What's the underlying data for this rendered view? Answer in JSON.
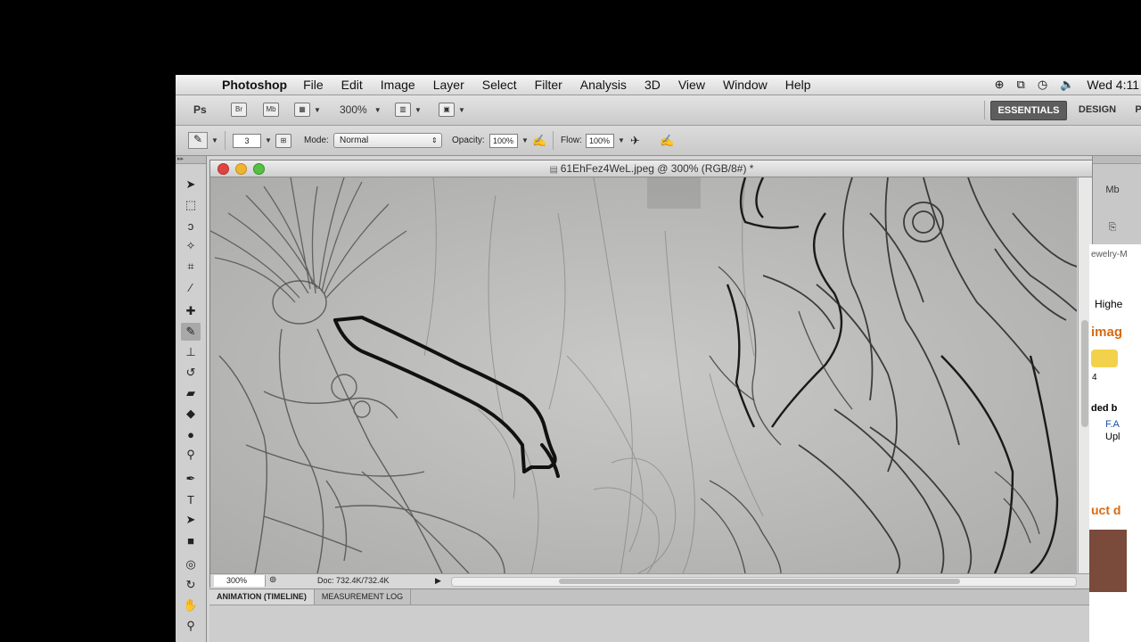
{
  "menubar": {
    "app": "Photoshop",
    "items": [
      "File",
      "Edit",
      "Image",
      "Layer",
      "Select",
      "Filter",
      "Analysis",
      "3D",
      "View",
      "Window",
      "Help"
    ],
    "clock": "Wed 4:11"
  },
  "appbar": {
    "logo": "Ps",
    "br": "Br",
    "mb": "Mb",
    "zoom": "300%",
    "workspaces": [
      "ESSENTIALS",
      "DESIGN",
      "P"
    ]
  },
  "options": {
    "brush_size": "3",
    "mode_label": "Mode:",
    "mode_value": "Normal",
    "opacity_label": "Opacity:",
    "opacity_value": "100%",
    "flow_label": "Flow:",
    "flow_value": "100%"
  },
  "document": {
    "title": "61EhFez4WeL.jpeg @ 300% (RGB/8#) *",
    "zoom": "300%",
    "doc_info": "Doc: 732.4K/732.4K"
  },
  "bottom_panel": {
    "tabs": [
      "ANIMATION (TIMELINE)",
      "MEASUREMENT LOG"
    ]
  },
  "background_page": {
    "texts": [
      "ewelry-M",
      "Highe",
      "imag",
      "4",
      "ded b",
      "F.A",
      "Upl",
      "uct d"
    ]
  },
  "colors": {
    "accent_orange": "#d86a10",
    "link_blue": "#1a4ea8",
    "selected_workspace": "#5d5d5d"
  }
}
